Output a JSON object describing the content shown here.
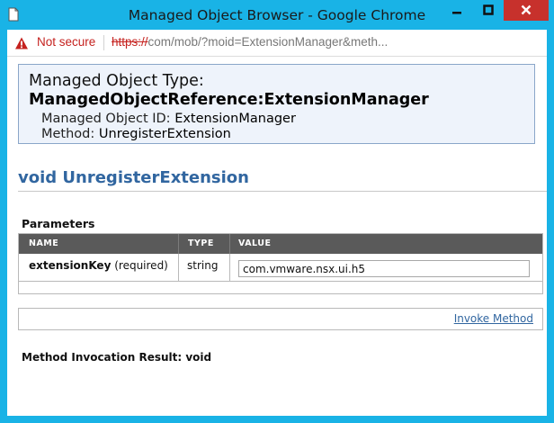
{
  "window": {
    "title": "Managed Object Browser - Google Chrome"
  },
  "address": {
    "security_label": "Not secure",
    "scheme": "https://",
    "rest": "com/mob/?moid=ExtensionManager&meth..."
  },
  "info": {
    "type_label": "Managed Object Type:",
    "type_value": "ManagedObjectReference:ExtensionManager",
    "id_label": "Managed Object ID:",
    "id_value": "ExtensionManager",
    "method_label": "Method:",
    "method_value": "UnregisterExtension"
  },
  "method_heading": "void UnregisterExtension",
  "parameters": {
    "label": "Parameters",
    "columns": [
      "NAME",
      "TYPE",
      "VALUE"
    ],
    "rows": [
      {
        "name": "extensionKey",
        "qualifier": "(required)",
        "type": "string",
        "value": "com.vmware.nsx.ui.h5"
      }
    ]
  },
  "invoke_label": "Invoke Method",
  "result_text": "Method Invocation Result: void",
  "colors": {
    "titlebar": "#19b3e6",
    "close_button": "#c7312c",
    "heading": "#3166a0",
    "table_header": "#5a5a5a",
    "info_bg": "#eef3fb",
    "info_border": "#8aa6c9",
    "not_secure": "#c5221f"
  },
  "icons": {
    "app": "chrome-page-icon",
    "warning": "warning-triangle-icon",
    "minimize": "minimize-icon",
    "maximize": "maximize-icon",
    "close": "close-icon"
  }
}
